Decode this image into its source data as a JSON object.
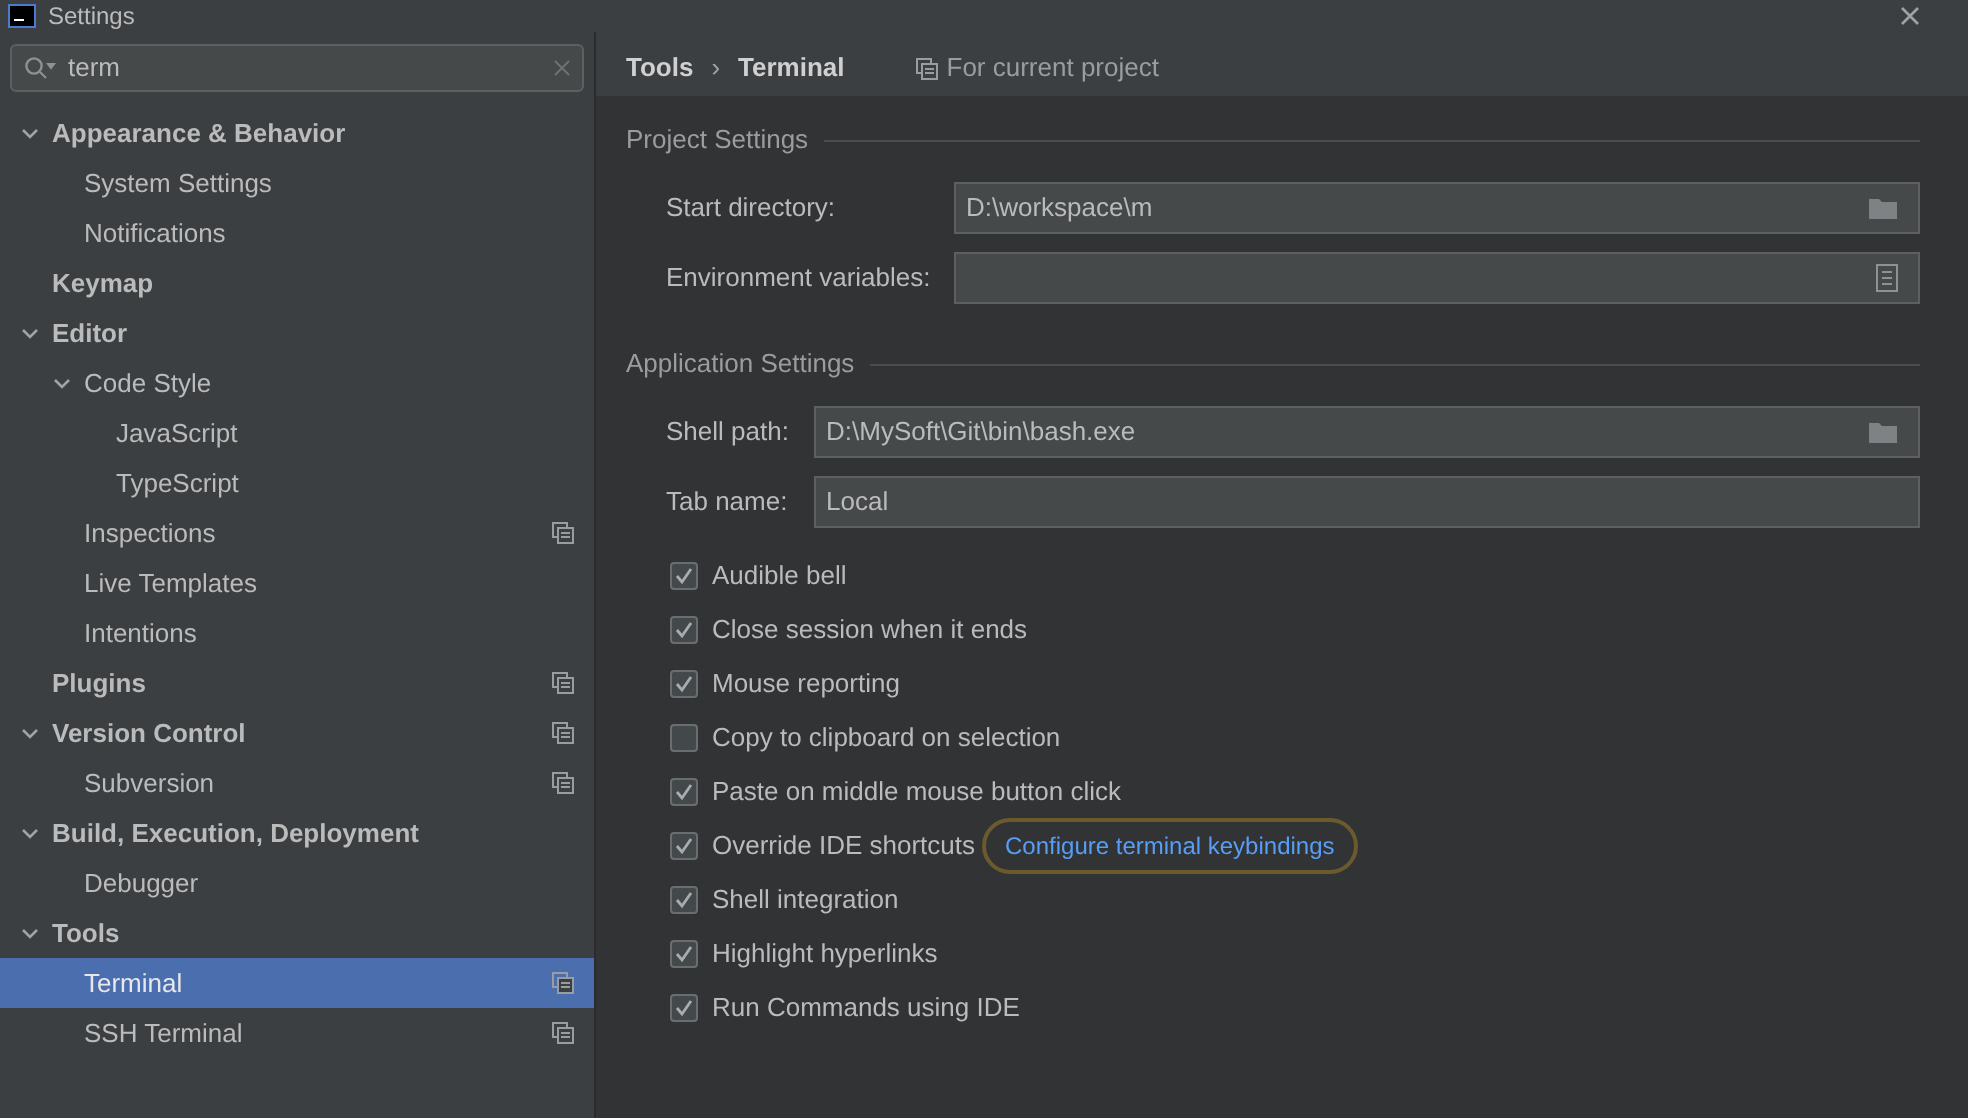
{
  "window": {
    "title": "Settings"
  },
  "search": {
    "value": "term"
  },
  "tree": [
    {
      "label": "Appearance & Behavior",
      "bold": true,
      "expanded": true,
      "project_scope": false,
      "selected": false,
      "children": [
        {
          "label": "System Settings",
          "bold": false,
          "project_scope": false,
          "selected": false
        },
        {
          "label": "Notifications",
          "bold": false,
          "project_scope": false,
          "selected": false
        }
      ]
    },
    {
      "label": "Keymap",
      "bold": true,
      "project_scope": false,
      "selected": false
    },
    {
      "label": "Editor",
      "bold": true,
      "expanded": true,
      "project_scope": false,
      "selected": false,
      "children": [
        {
          "label": "Code Style",
          "bold": false,
          "expanded": true,
          "project_scope": false,
          "selected": false,
          "children": [
            {
              "label": "JavaScript",
              "bold": false,
              "project_scope": false,
              "selected": false
            },
            {
              "label": "TypeScript",
              "bold": false,
              "project_scope": false,
              "selected": false
            }
          ]
        },
        {
          "label": "Inspections",
          "bold": false,
          "project_scope": true,
          "selected": false
        },
        {
          "label": "Live Templates",
          "bold": false,
          "project_scope": false,
          "selected": false
        },
        {
          "label": "Intentions",
          "bold": false,
          "project_scope": false,
          "selected": false
        }
      ]
    },
    {
      "label": "Plugins",
      "bold": true,
      "project_scope": true,
      "selected": false
    },
    {
      "label": "Version Control",
      "bold": true,
      "expanded": true,
      "project_scope": true,
      "selected": false,
      "children": [
        {
          "label": "Subversion",
          "bold": false,
          "project_scope": true,
          "selected": false
        }
      ]
    },
    {
      "label": "Build, Execution, Deployment",
      "bold": true,
      "expanded": true,
      "project_scope": false,
      "selected": false,
      "children": [
        {
          "label": "Debugger",
          "bold": false,
          "project_scope": false,
          "selected": false
        }
      ]
    },
    {
      "label": "Tools",
      "bold": true,
      "expanded": true,
      "project_scope": false,
      "selected": false,
      "children": [
        {
          "label": "Terminal",
          "bold": false,
          "project_scope": true,
          "selected": true
        },
        {
          "label": "SSH Terminal",
          "bold": false,
          "project_scope": true,
          "selected": false
        }
      ]
    }
  ],
  "breadcrumb": [
    "Tools",
    "Terminal"
  ],
  "breadcrumb_separator": "›",
  "scope_note": "For current project",
  "project_settings": {
    "title": "Project Settings",
    "fields": [
      {
        "label": "Start directory:",
        "value": "D:\\workspace\\m",
        "kind": "folder"
      },
      {
        "label": "Environment variables:",
        "kind": "list"
      }
    ]
  },
  "application_settings": {
    "title": "Application Settings",
    "fields": [
      {
        "label": "Shell path:",
        "value": "D:\\MySoft\\Git\\bin\\bash.exe",
        "kind": "folder"
      },
      {
        "label": "Tab name:",
        "value": "Local",
        "kind": "text"
      }
    ],
    "options": [
      {
        "label": "Audible bell",
        "checked": true
      },
      {
        "label": "Close session when it ends",
        "checked": true
      },
      {
        "label": "Mouse reporting",
        "checked": true
      },
      {
        "label": "Copy to clipboard on selection",
        "checked": false
      },
      {
        "label": "Paste on middle mouse button click",
        "checked": true
      },
      {
        "label": "Override IDE shortcuts",
        "checked": true,
        "link": "Configure terminal keybindings"
      },
      {
        "label": "Shell integration",
        "checked": true
      },
      {
        "label": "Highlight hyperlinks",
        "checked": true
      },
      {
        "label": "Run Commands using IDE",
        "checked": true
      }
    ]
  }
}
